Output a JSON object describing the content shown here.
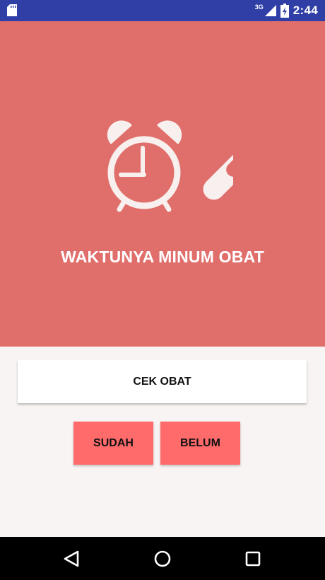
{
  "status_bar": {
    "network_label": "3G",
    "time": "2:44",
    "icons": [
      "sd-card-icon",
      "signal-icon",
      "battery-icon"
    ]
  },
  "hero": {
    "title": "WAKTUNYA MINUM OBAT",
    "icons": [
      "alarm-clock-icon",
      "pill-icon"
    ],
    "background_color": "#e06f6c"
  },
  "actions": {
    "check_label": "CEK OBAT",
    "done_label": "SUDAH",
    "not_yet_label": "BELUM",
    "choice_color": "#ff6b6b"
  },
  "nav_bar": {
    "icons": [
      "back-icon",
      "home-icon",
      "recent-apps-icon"
    ]
  }
}
